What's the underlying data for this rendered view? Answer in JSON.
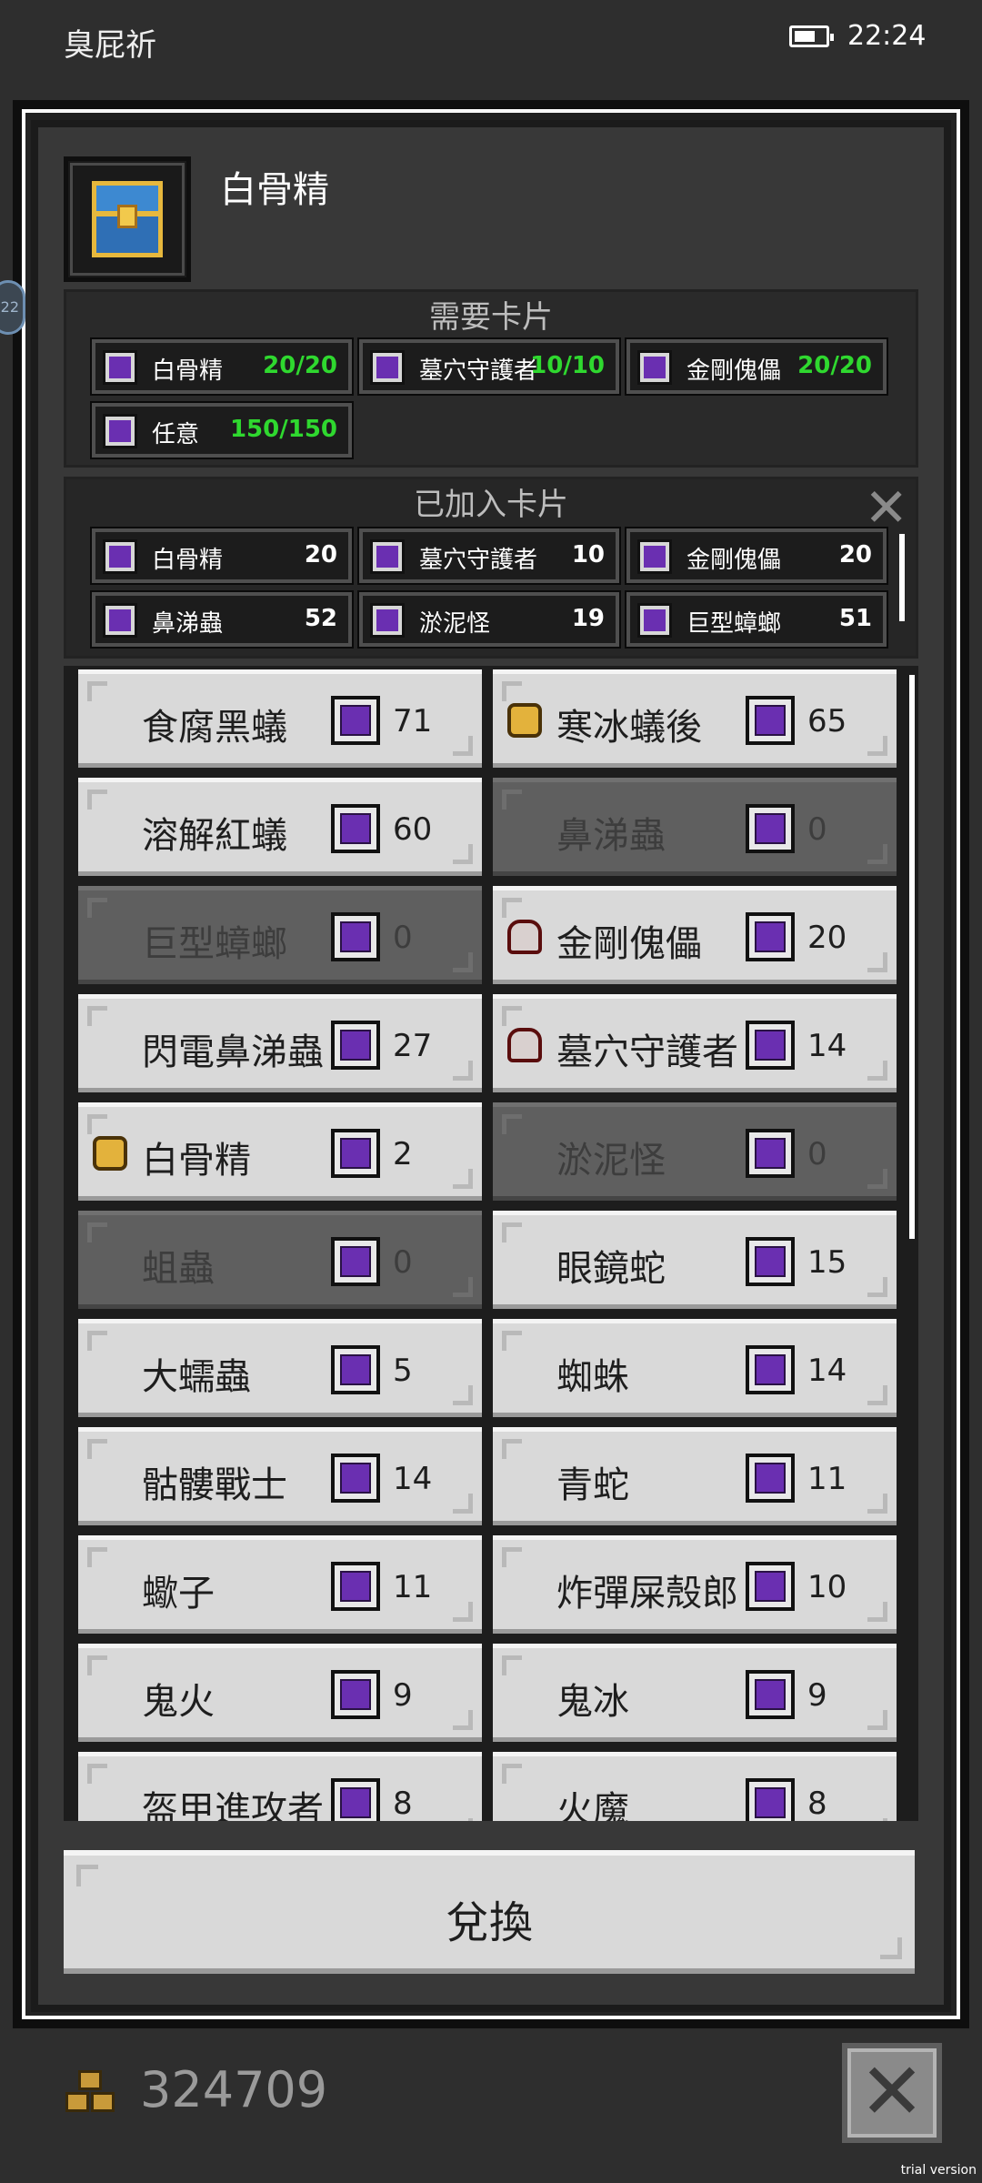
{
  "status_bar": {
    "app_name": "臭屁祈",
    "time": "22:24",
    "battery_icon": "battery-icon"
  },
  "side_tab": {
    "label": "22"
  },
  "boss": {
    "name": "白骨精",
    "icon": "treasure-chest-icon"
  },
  "required": {
    "title": "需要卡片",
    "cards": [
      {
        "name": "白骨精",
        "value": "20/20"
      },
      {
        "name": "墓穴守護者",
        "value": "10/10"
      },
      {
        "name": "金剛傀儡",
        "value": "20/20"
      },
      {
        "name": "任意",
        "value": "150/150"
      }
    ]
  },
  "added": {
    "title": "已加入卡片",
    "cards": [
      {
        "name": "白骨精",
        "value": "20"
      },
      {
        "name": "墓穴守護者",
        "value": "10"
      },
      {
        "name": "金剛傀儡",
        "value": "20"
      },
      {
        "name": "鼻涕蟲",
        "value": "52"
      },
      {
        "name": "淤泥怪",
        "value": "19"
      },
      {
        "name": "巨型蟑螂",
        "value": "51"
      }
    ]
  },
  "monsters": [
    {
      "name": "食腐黑蟻",
      "count": "71",
      "disabled": false,
      "icon": ""
    },
    {
      "name": "寒冰蟻後",
      "count": "65",
      "disabled": false,
      "icon": "gold"
    },
    {
      "name": "溶解紅蟻",
      "count": "60",
      "disabled": false,
      "icon": ""
    },
    {
      "name": "鼻涕蟲",
      "count": "0",
      "disabled": true,
      "icon": ""
    },
    {
      "name": "巨型蟑螂",
      "count": "0",
      "disabled": true,
      "icon": ""
    },
    {
      "name": "金剛傀儡",
      "count": "20",
      "disabled": false,
      "icon": "mask"
    },
    {
      "name": "閃電鼻涕蟲",
      "count": "27",
      "disabled": false,
      "icon": ""
    },
    {
      "name": "墓穴守護者",
      "count": "14",
      "disabled": false,
      "icon": "mask"
    },
    {
      "name": "白骨精",
      "count": "2",
      "disabled": false,
      "icon": "gold"
    },
    {
      "name": "淤泥怪",
      "count": "0",
      "disabled": true,
      "icon": ""
    },
    {
      "name": "蛆蟲",
      "count": "0",
      "disabled": true,
      "icon": ""
    },
    {
      "name": "眼鏡蛇",
      "count": "15",
      "disabled": false,
      "icon": ""
    },
    {
      "name": "大蠕蟲",
      "count": "5",
      "disabled": false,
      "icon": ""
    },
    {
      "name": "蜘蛛",
      "count": "14",
      "disabled": false,
      "icon": ""
    },
    {
      "name": "骷髏戰士",
      "count": "14",
      "disabled": false,
      "icon": ""
    },
    {
      "name": "青蛇",
      "count": "11",
      "disabled": false,
      "icon": ""
    },
    {
      "name": "蠍子",
      "count": "11",
      "disabled": false,
      "icon": ""
    },
    {
      "name": "炸彈屎殼郎",
      "count": "10",
      "disabled": false,
      "icon": ""
    },
    {
      "name": "鬼火",
      "count": "9",
      "disabled": false,
      "icon": ""
    },
    {
      "name": "鬼冰",
      "count": "9",
      "disabled": false,
      "icon": ""
    },
    {
      "name": "盔甲進攻者",
      "count": "8",
      "disabled": false,
      "icon": ""
    },
    {
      "name": "火魔",
      "count": "8",
      "disabled": false,
      "icon": ""
    }
  ],
  "exchange": {
    "label": "兌換"
  },
  "gold": {
    "amount": "324709",
    "icon": "gold-coins-icon"
  },
  "close_button": {
    "icon": "close-icon",
    "symbol": "✕"
  },
  "watermark": "trial version"
}
